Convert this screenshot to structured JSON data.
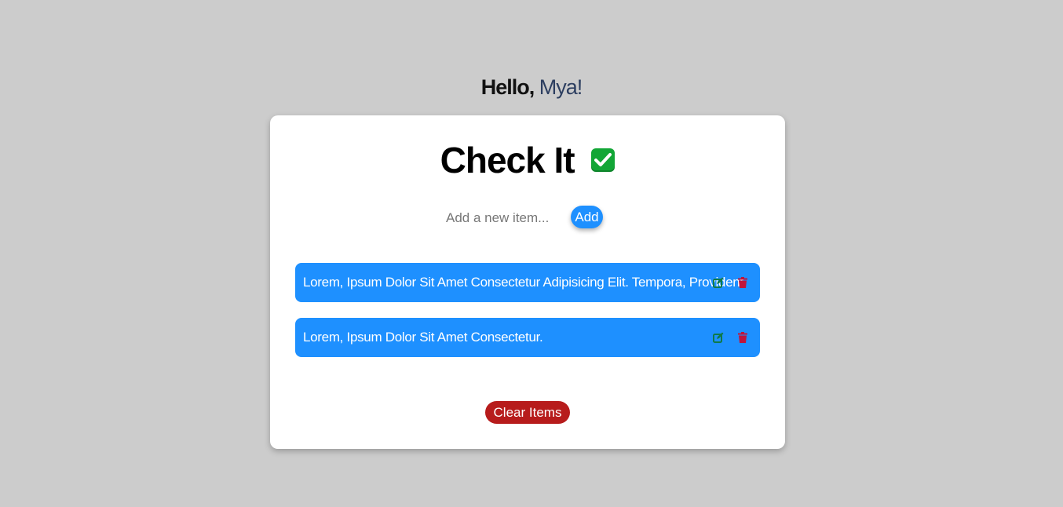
{
  "header": {
    "greeting_prefix": "Hello,",
    "user_name": "Mya!"
  },
  "app": {
    "title": "Check It",
    "title_icon": "check-mark-button-icon"
  },
  "add_form": {
    "placeholder": "Add a new item...",
    "value": "",
    "add_label": "Add"
  },
  "items": [
    {
      "text": "Lorem, Ipsum Dolor Sit Amet Consectetur Adipisicing Elit. Tempora, Provident."
    },
    {
      "text": "Lorem, Ipsum Dolor Sit Amet Consectetur."
    }
  ],
  "icons": {
    "edit": "edit-icon",
    "delete": "trash-icon"
  },
  "clear_button": {
    "label": "Clear Items"
  },
  "colors": {
    "background": "#cccccc",
    "card": "#ffffff",
    "accent_blue": "#1e90ff",
    "danger_red": "#b71c1c",
    "edit_icon": "#0f7a4a",
    "delete_icon": "#c0143c",
    "check_green": "#12a636"
  }
}
